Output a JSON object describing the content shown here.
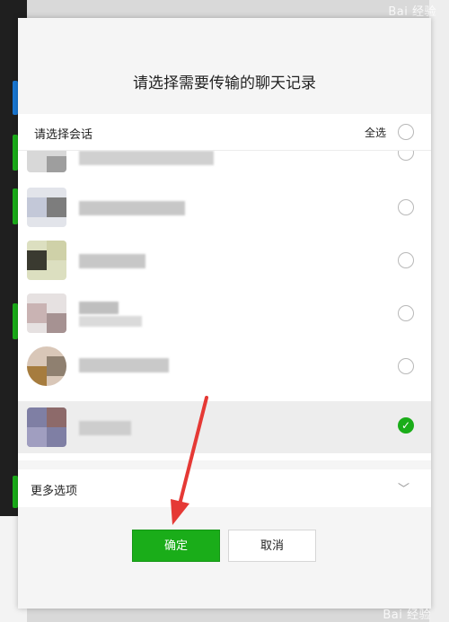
{
  "dialog": {
    "title": "请选择需要传输的聊天记录",
    "select_header": "请选择会话",
    "select_all": "全选",
    "more_options": "更多选项",
    "confirm": "确定",
    "cancel": "取消"
  },
  "conversations": [
    {
      "name": "",
      "selected": false
    },
    {
      "name": "",
      "selected": false
    },
    {
      "name": "",
      "selected": false
    },
    {
      "name": "",
      "selected": false
    },
    {
      "name": "",
      "selected": false
    },
    {
      "name": "",
      "selected": true
    }
  ],
  "watermark": {
    "top": "Bai 经验",
    "bottom": "Bai 经验"
  },
  "colors": {
    "accent": "#1aad19",
    "arrow": "#e53935"
  }
}
